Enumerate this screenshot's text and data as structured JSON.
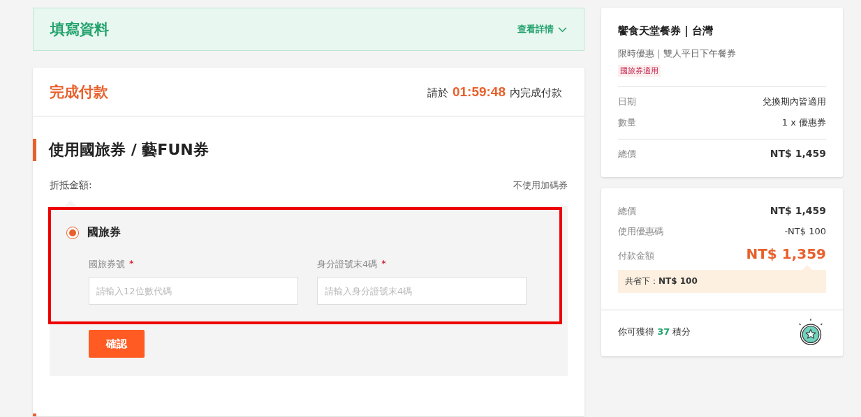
{
  "info_bar": {
    "title": "填寫資料",
    "details_link": "查看詳情",
    "expanded": false
  },
  "payment": {
    "title": "完成付款",
    "deadline_prefix": "請於",
    "countdown": "01:59:48",
    "deadline_suffix": "內完成付款",
    "section_title": "使用國旅券 / 藝FUN券",
    "discount_label": "折抵金額:",
    "no_coupon_link": "不使用加碼券",
    "voucher_option": {
      "label": "國旅券",
      "selected": true
    },
    "fields": [
      {
        "label": "國旅券號",
        "required_mark": "*",
        "placeholder": "請輸入12位數代碼"
      },
      {
        "label": "身分證號末4碼",
        "required_mark": "*",
        "placeholder": "請輸入身分證號末4碼"
      }
    ],
    "confirm_button": "確認",
    "highlighted": true
  },
  "product": {
    "title": "饗食天堂餐券 | 台灣",
    "subtitle": "限時優惠｜雙人平日下午餐券",
    "tag": "國旅券適用",
    "details": [
      {
        "label": "日期",
        "value": "兌換期內皆適用"
      },
      {
        "label": "數量",
        "value": "1 x 優惠券"
      }
    ],
    "total_label": "總價",
    "total_value": "NT$ 1,459"
  },
  "summary": {
    "rows": [
      {
        "label": "總價",
        "value": "NT$ 1,459",
        "kind": "total"
      },
      {
        "label": "使用優惠碼",
        "value": "-NT$ 100",
        "kind": "discount"
      },
      {
        "label": "付款金額",
        "value": "NT$ 1,359",
        "kind": "payable"
      }
    ],
    "savings_label": "共省下：",
    "savings_value": "NT$ 100",
    "points_prefix": "你可獲得",
    "points": "37",
    "points_suffix": "積分"
  }
}
